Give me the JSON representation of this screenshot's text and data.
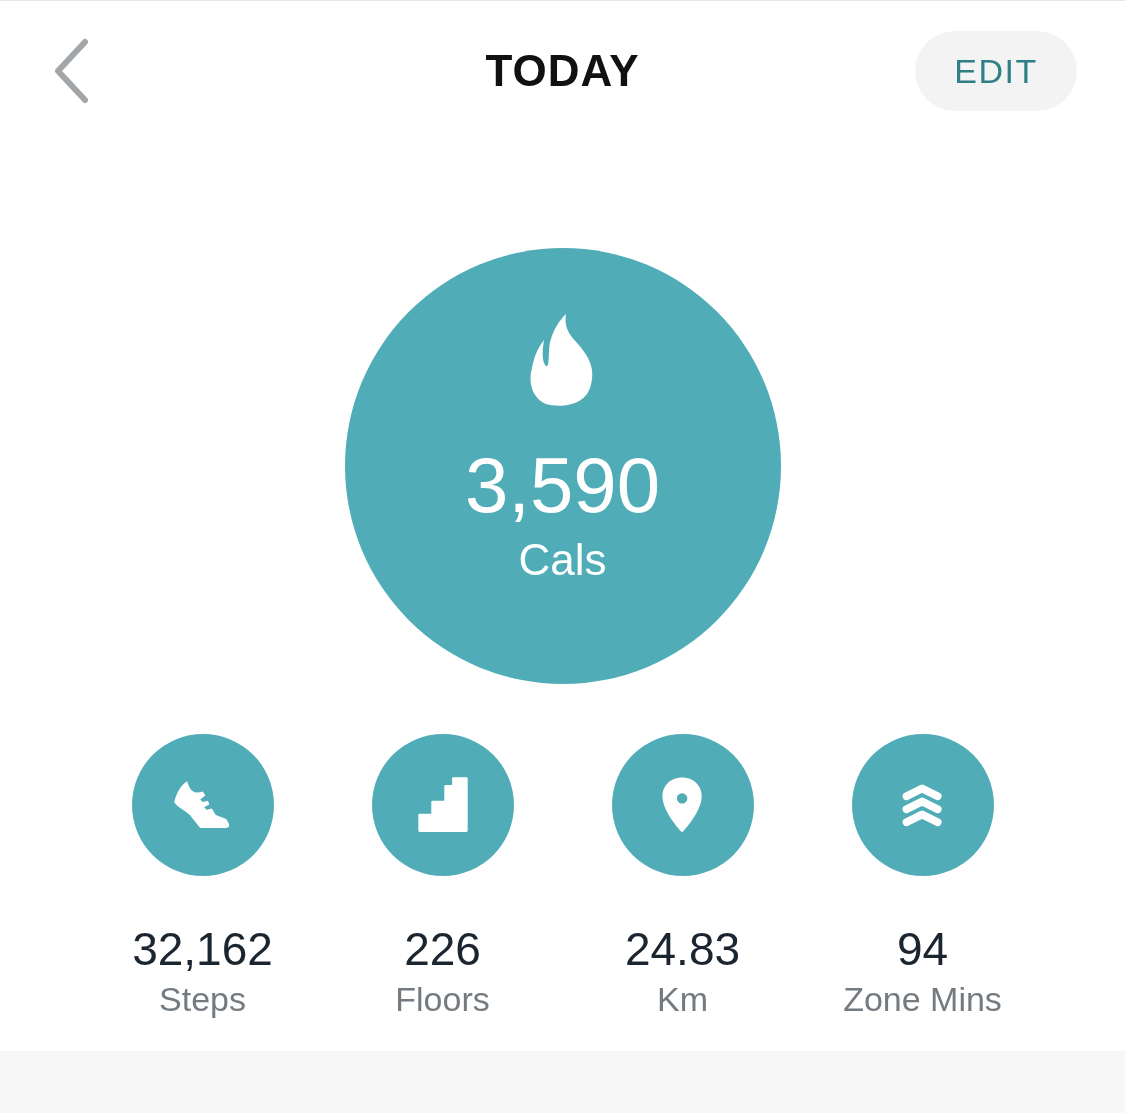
{
  "header": {
    "title": "TODAY",
    "edit_button": "EDIT"
  },
  "calories": {
    "value": "3,590",
    "unit": "Cals"
  },
  "metrics": [
    {
      "kind": "steps",
      "value": "32,162",
      "label": "Steps"
    },
    {
      "kind": "floors",
      "value": "226",
      "label": "Floors"
    },
    {
      "kind": "distance",
      "value": "24.83",
      "label": "Km"
    },
    {
      "kind": "zone",
      "value": "94",
      "label": "Zone Mins"
    }
  ]
}
